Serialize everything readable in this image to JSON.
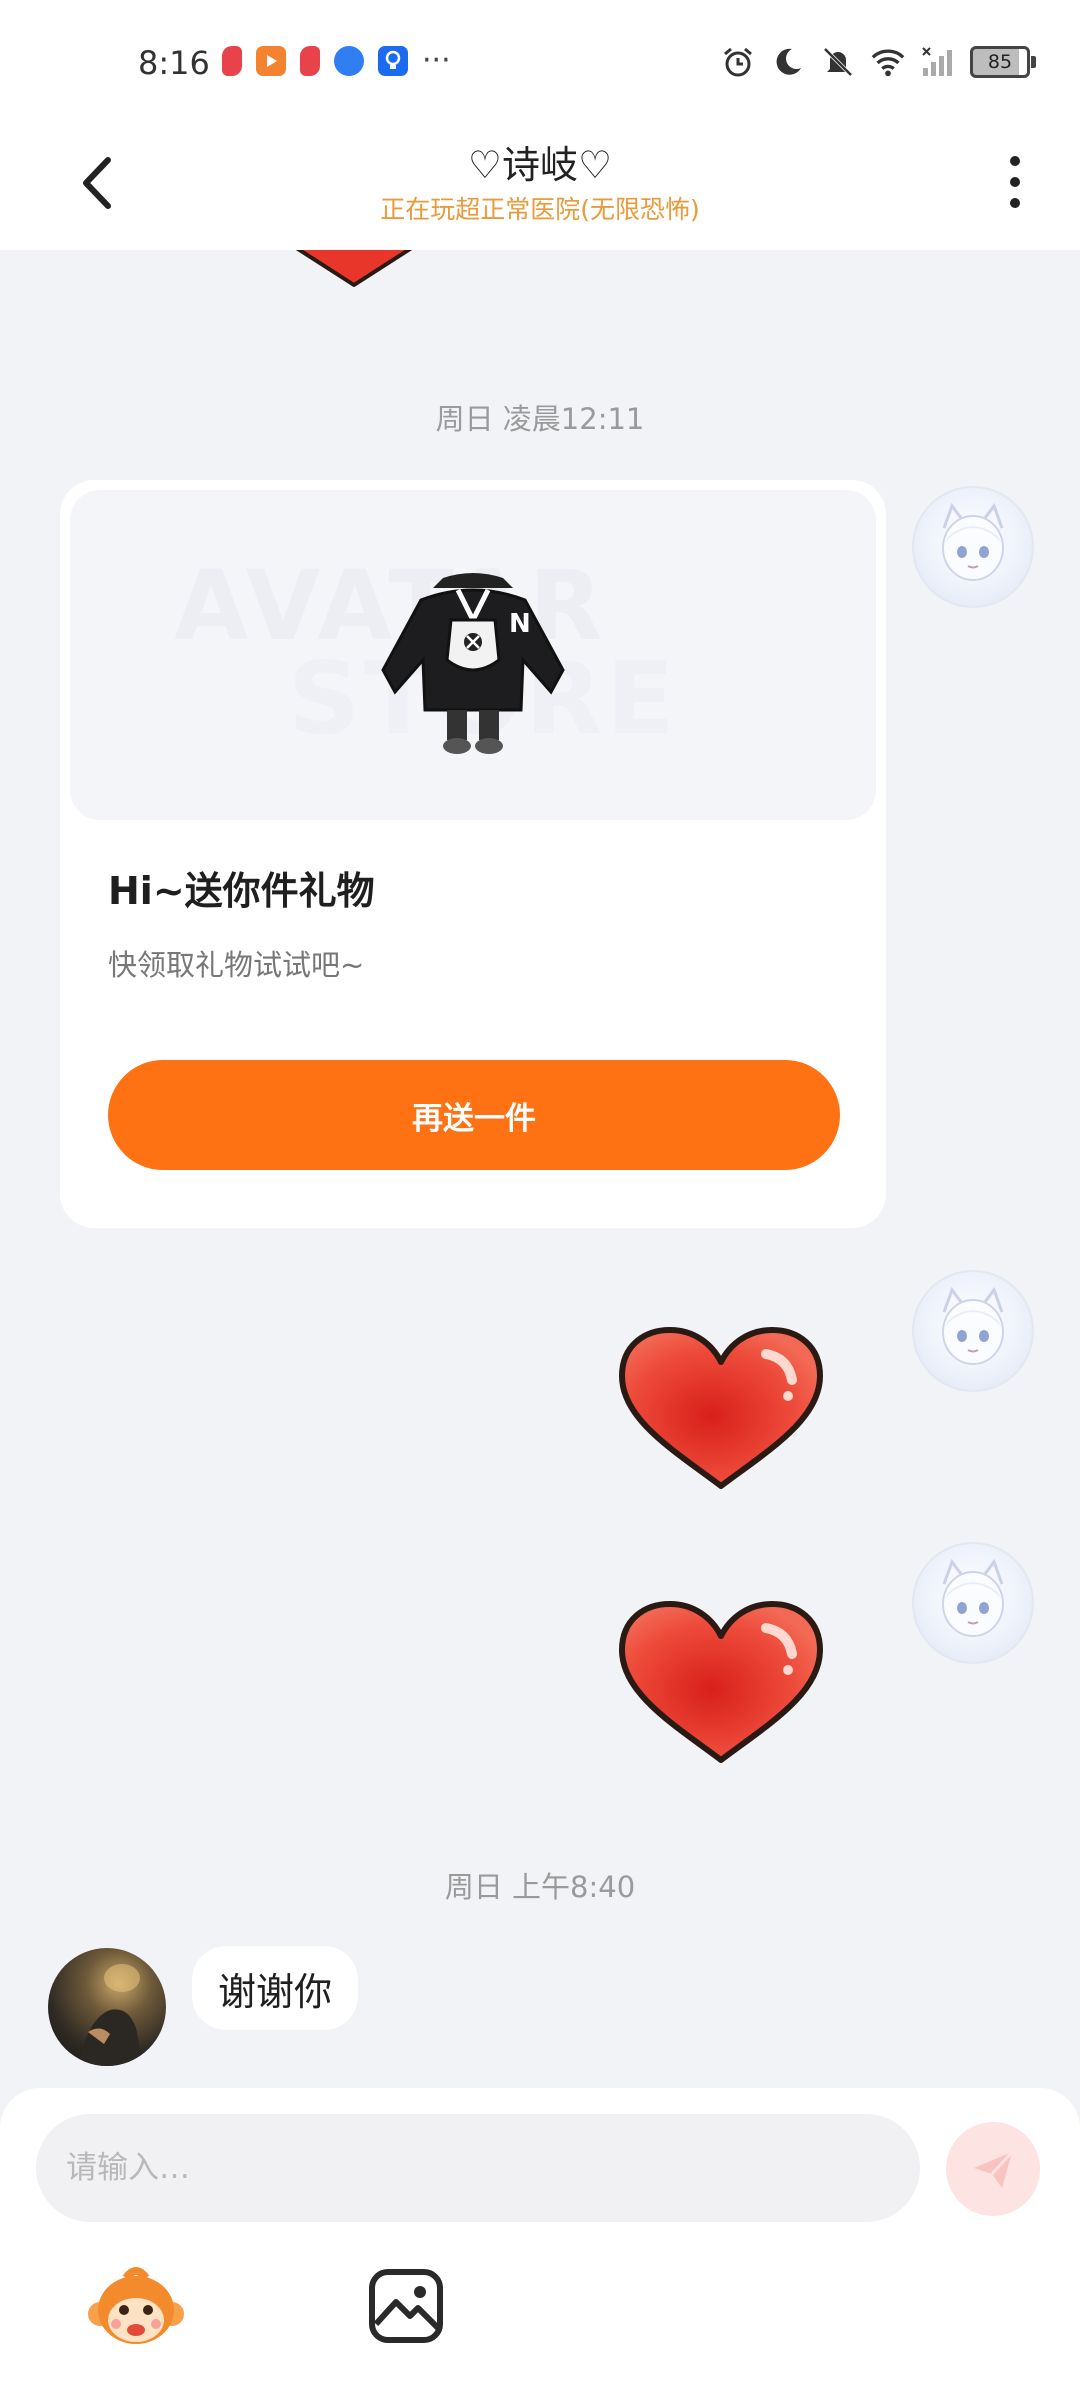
{
  "status_bar": {
    "time": "8:16",
    "battery": "85",
    "left_icons": [
      "red-app-icon",
      "orange-play-app-icon",
      "red-app-icon",
      "blue-globe-app-icon",
      "blue-bulb-app-icon",
      "more-dots-icon"
    ],
    "right_icons": [
      "alarm-icon",
      "moon-icon",
      "mute-icon",
      "wifi-icon",
      "signal-icon",
      "battery-icon"
    ]
  },
  "header": {
    "title": "♡诗岐♡",
    "subtitle": "正在玩超正常医院(无限恐怖)"
  },
  "chat": {
    "timestamp_1": "周日 凌晨12:11",
    "gift_card": {
      "title": "Hi~送你件礼物",
      "description": "快领取礼物试试吧~",
      "button_label": "再送一件",
      "watermark": "AVATAR STORE"
    },
    "timestamp_2": "周日 上午8:40",
    "incoming_message": "谢谢你"
  },
  "input_bar": {
    "placeholder": "请输入…"
  },
  "colors": {
    "accent": "#ff7214",
    "subtitle": "#e99a3a",
    "background": "#f1f3f7",
    "heart": "#e8372a"
  }
}
